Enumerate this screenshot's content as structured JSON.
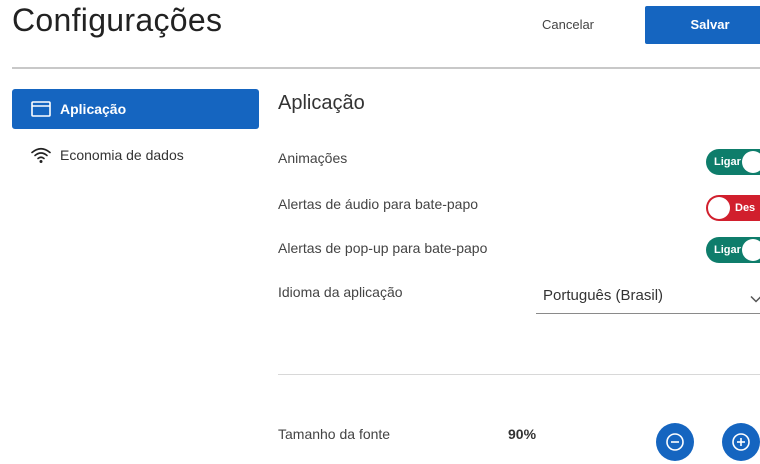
{
  "header": {
    "title": "Configurações",
    "cancel_label": "Cancelar",
    "save_label": "Salvar"
  },
  "sidebar": {
    "items": [
      {
        "label": "Aplicação",
        "icon": "window-icon",
        "active": true
      },
      {
        "label": "Economia de dados",
        "icon": "wifi-icon",
        "active": false
      }
    ]
  },
  "main": {
    "section_title": "Aplicação",
    "settings": [
      {
        "label": "Animações",
        "toggle_text": "Ligar",
        "state": "on"
      },
      {
        "label": "Alertas de áudio para bate-papo",
        "toggle_text": "Des",
        "state": "off"
      },
      {
        "label": "Alertas de pop-up para bate-papo",
        "toggle_text": "Ligar",
        "state": "on"
      }
    ],
    "language": {
      "label": "Idioma da aplicação",
      "value": "Português (Brasil)"
    },
    "font_size": {
      "label": "Tamanho da fonte",
      "value": "90%",
      "decrease_icon": "minus-circle-icon",
      "increase_icon": "plus-circle-icon"
    }
  },
  "colors": {
    "primary": "#1565c0",
    "toggle_on": "#0e7d6b",
    "toggle_off": "#d11f2d"
  }
}
